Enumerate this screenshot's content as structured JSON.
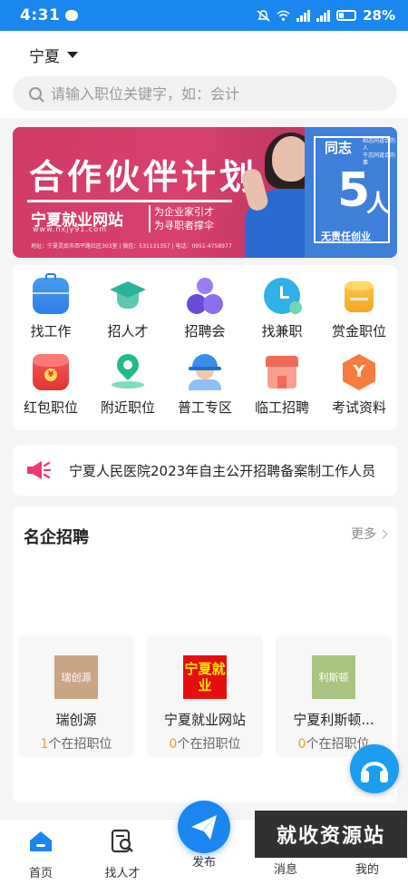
{
  "status_bar": {
    "time": "4:31",
    "battery": "28%"
  },
  "header": {
    "region": "宁夏",
    "search_placeholder": "请输入职位关键字，如：会计"
  },
  "banner": {
    "title": "合作伙伴计划",
    "site_name": "宁夏就业网站",
    "site_url": "www.nxjy91.com",
    "slogan_line1": "为企业家引才",
    "slogan_line2": "为寻职者撑伞",
    "contact": "地址：宁夏灵武市西平路社区303室 | 微信：531131357 | 电话：0951-4758977",
    "right_title": "同志",
    "right_small_line1": "和志同道合的人",
    "right_small_line2": "干志同道合的事",
    "number": "5",
    "number_unit": "人",
    "right_footer": "无责任创业"
  },
  "grid": [
    {
      "label": "找工作",
      "icon": "briefcase-icon",
      "color": "#2f7fe6"
    },
    {
      "label": "招人才",
      "icon": "graduation-cap-icon",
      "color": "#2bb39a"
    },
    {
      "label": "招聘会",
      "icon": "people-group-icon",
      "color": "#7a5ae0"
    },
    {
      "label": "找兼职",
      "icon": "clock-icon",
      "color": "#2fb0e8"
    },
    {
      "label": "赏金职位",
      "icon": "coin-stack-icon",
      "color": "#f5a623"
    },
    {
      "label": "红包职位",
      "icon": "red-envelope-icon",
      "color": "#e94343"
    },
    {
      "label": "附近职位",
      "icon": "location-pin-icon",
      "color": "#22b88a"
    },
    {
      "label": "普工专区",
      "icon": "worker-helmet-icon",
      "color": "#3a8de8"
    },
    {
      "label": "临工招聘",
      "icon": "store-icon",
      "color": "#f06a5a"
    },
    {
      "label": "考试资料",
      "icon": "hexagon-y-icon",
      "color": "#f47c3c"
    }
  ],
  "notice": {
    "text": "宁夏人民医院2023年自主公开招聘备案制工作人员"
  },
  "famous": {
    "title": "名企招聘",
    "more": "更多",
    "companies": [
      {
        "name": "瑞创源",
        "logo_text": "瑞创源",
        "count": "1",
        "suffix": "个在招职位"
      },
      {
        "name": "宁夏就业网站",
        "logo_text": "宁夏就业",
        "count": "0",
        "suffix": "个在招职位"
      },
      {
        "name": "宁夏利斯顿...",
        "logo_text": "利斯顿",
        "count": "0",
        "suffix": "个在招职位"
      }
    ]
  },
  "tabs": [
    {
      "label": "首页",
      "icon": "home-icon"
    },
    {
      "label": "找人才",
      "icon": "document-search-icon"
    },
    {
      "label": "发布",
      "icon": "paper-plane-icon"
    },
    {
      "label": "消息",
      "icon": "message-icon"
    },
    {
      "label": "我的",
      "icon": "profile-icon"
    }
  ],
  "watermark": "就收资源站",
  "colors": {
    "primary": "#1a86f0",
    "accent_orange": "#f39b23"
  }
}
